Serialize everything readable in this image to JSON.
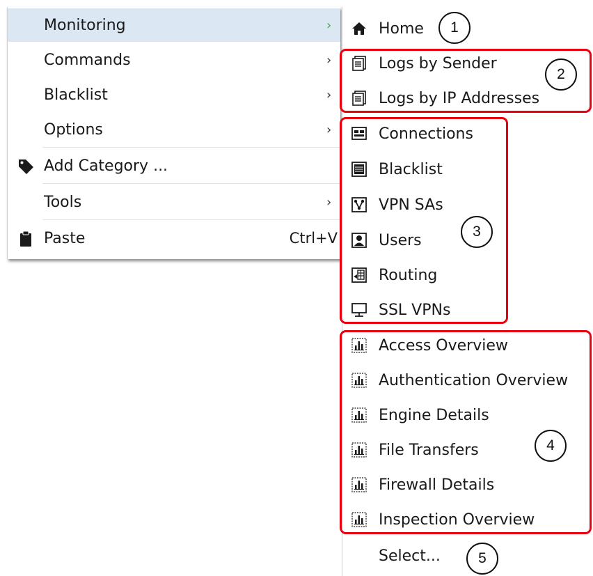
{
  "main_menu": {
    "items": [
      {
        "label": "Monitoring",
        "has_submenu": true,
        "highlighted": true
      },
      {
        "label": "Commands",
        "has_submenu": true
      },
      {
        "label": "Blacklist",
        "has_submenu": true
      },
      {
        "label": "Options",
        "has_submenu": true
      },
      {
        "label": "Add Category ...",
        "icon": "tag-icon"
      },
      {
        "label": "Tools",
        "has_submenu": true
      },
      {
        "label": "Paste",
        "icon": "clipboard-icon",
        "shortcut": "Ctrl+V"
      }
    ],
    "submenu_arrow": "›"
  },
  "submenu": {
    "items": [
      {
        "label": "Home",
        "icon": "home-icon"
      },
      {
        "label": "Logs by Sender",
        "icon": "log-document-icon"
      },
      {
        "label": "Logs by IP Addresses",
        "icon": "log-document-icon"
      },
      {
        "label": "Connections",
        "icon": "connections-icon"
      },
      {
        "label": "Blacklist",
        "icon": "blacklist-icon"
      },
      {
        "label": "VPN SAs",
        "icon": "vpn-sa-icon"
      },
      {
        "label": "Users",
        "icon": "user-icon"
      },
      {
        "label": "Routing",
        "icon": "routing-icon"
      },
      {
        "label": "SSL VPNs",
        "icon": "monitor-icon"
      },
      {
        "label": "Access Overview",
        "icon": "report-chart-icon"
      },
      {
        "label": "Authentication Overview",
        "icon": "report-chart-icon"
      },
      {
        "label": "Engine Details",
        "icon": "report-chart-icon"
      },
      {
        "label": "File Transfers",
        "icon": "report-chart-icon"
      },
      {
        "label": "Firewall Details",
        "icon": "report-chart-icon"
      },
      {
        "label": "Inspection Overview",
        "icon": "report-chart-icon"
      },
      {
        "label": "Select..."
      }
    ]
  },
  "annotations": {
    "numbers": [
      "1",
      "2",
      "3",
      "4",
      "5"
    ],
    "highlight_color": "#e8000f",
    "menu_highlight_color": "#dbe8f4"
  }
}
